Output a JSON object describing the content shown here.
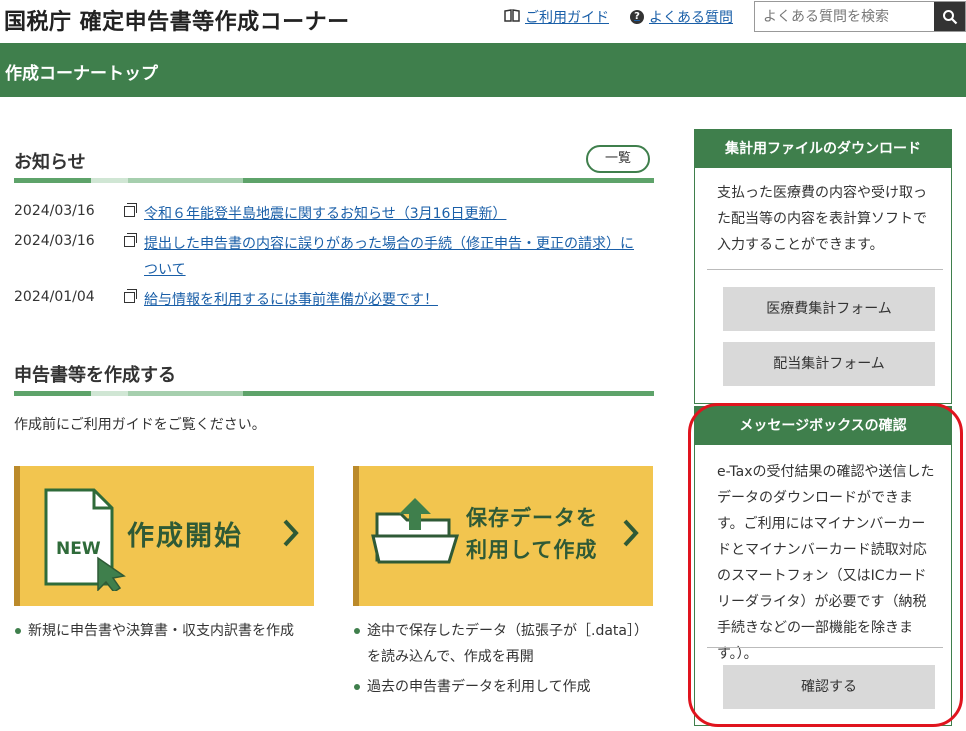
{
  "header": {
    "site_title": "国税庁 確定申告書等作成コーナー",
    "guide_link": "ご利用ガイド",
    "faq_link": "よくある質問",
    "search_placeholder": "よくある質問を検索"
  },
  "greenbar": {
    "title": "作成コーナートップ"
  },
  "news": {
    "title": "お知らせ",
    "list_button": "一覧",
    "items": [
      {
        "date": "2024/03/16",
        "text": "令和６年能登半島地震に関するお知らせ（3月16日更新）"
      },
      {
        "date": "2024/03/16",
        "text": "提出した申告書の内容に誤りがあった場合の手続（修正申告・更正の請求）について"
      },
      {
        "date": "2024/01/04",
        "text": "給与情報を利用するには事前準備が必要です！"
      }
    ]
  },
  "create": {
    "title": "申告書等を作成する",
    "intro": "作成前にご利用ガイドをご覧ください。",
    "card_new": {
      "badge": "NEW",
      "label": "作成開始",
      "bullets": [
        "新規に申告書や決算書・収支内訳書を作成"
      ]
    },
    "card_saved": {
      "label_line1": "保存データを",
      "label_line2": "利用して作成",
      "bullets": [
        "途中で保存したデータ（拡張子が［.data］）を読み込んで、作成を再開",
        "過去の申告書データを利用して作成"
      ]
    }
  },
  "sidebar": {
    "download": {
      "title": "集計用ファイルのダウンロード",
      "text": "支払った医療費の内容や受け取った配当等の内容を表計算ソフトで入力することができます。",
      "buttons": [
        "医療費集計フォーム",
        "配当集計フォーム"
      ]
    },
    "message": {
      "title": "メッセージボックスの確認",
      "text": "e-Taxの受付結果の確認や送信したデータのダウンロードができます。ご利用にはマイナンバーカードとマイナンバーカード読取対応のスマートフォン（又はICカードリーダライタ）が必要です（納税手続きなどの一部機能を除きます。）。",
      "button": "確認する"
    }
  },
  "colors": {
    "brand_green": "#3f7f4c",
    "card_yellow": "#f2c54f",
    "link_blue": "#1a5fa8",
    "highlight_red": "#e0141e"
  }
}
